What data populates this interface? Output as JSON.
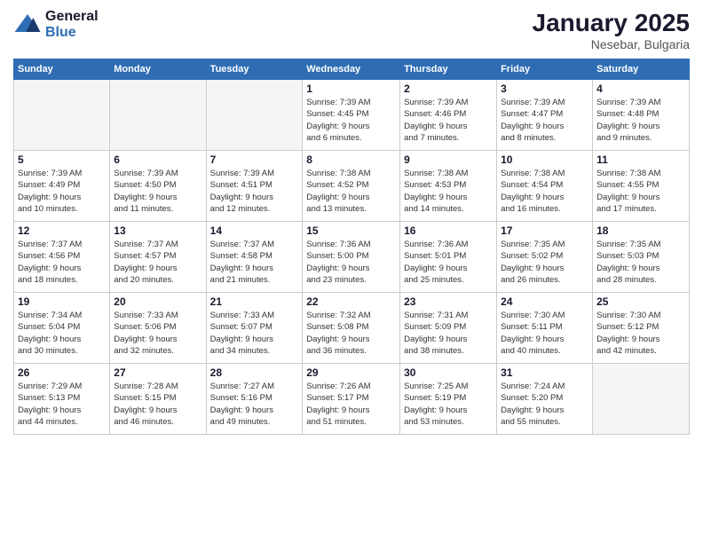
{
  "header": {
    "logo_line1": "General",
    "logo_line2": "Blue",
    "month": "January 2025",
    "location": "Nesebar, Bulgaria"
  },
  "weekdays": [
    "Sunday",
    "Monday",
    "Tuesday",
    "Wednesday",
    "Thursday",
    "Friday",
    "Saturday"
  ],
  "days": [
    {
      "num": "",
      "info": ""
    },
    {
      "num": "",
      "info": ""
    },
    {
      "num": "",
      "info": ""
    },
    {
      "num": "1",
      "info": "Sunrise: 7:39 AM\nSunset: 4:45 PM\nDaylight: 9 hours\nand 6 minutes."
    },
    {
      "num": "2",
      "info": "Sunrise: 7:39 AM\nSunset: 4:46 PM\nDaylight: 9 hours\nand 7 minutes."
    },
    {
      "num": "3",
      "info": "Sunrise: 7:39 AM\nSunset: 4:47 PM\nDaylight: 9 hours\nand 8 minutes."
    },
    {
      "num": "4",
      "info": "Sunrise: 7:39 AM\nSunset: 4:48 PM\nDaylight: 9 hours\nand 9 minutes."
    },
    {
      "num": "5",
      "info": "Sunrise: 7:39 AM\nSunset: 4:49 PM\nDaylight: 9 hours\nand 10 minutes."
    },
    {
      "num": "6",
      "info": "Sunrise: 7:39 AM\nSunset: 4:50 PM\nDaylight: 9 hours\nand 11 minutes."
    },
    {
      "num": "7",
      "info": "Sunrise: 7:39 AM\nSunset: 4:51 PM\nDaylight: 9 hours\nand 12 minutes."
    },
    {
      "num": "8",
      "info": "Sunrise: 7:38 AM\nSunset: 4:52 PM\nDaylight: 9 hours\nand 13 minutes."
    },
    {
      "num": "9",
      "info": "Sunrise: 7:38 AM\nSunset: 4:53 PM\nDaylight: 9 hours\nand 14 minutes."
    },
    {
      "num": "10",
      "info": "Sunrise: 7:38 AM\nSunset: 4:54 PM\nDaylight: 9 hours\nand 16 minutes."
    },
    {
      "num": "11",
      "info": "Sunrise: 7:38 AM\nSunset: 4:55 PM\nDaylight: 9 hours\nand 17 minutes."
    },
    {
      "num": "12",
      "info": "Sunrise: 7:37 AM\nSunset: 4:56 PM\nDaylight: 9 hours\nand 18 minutes."
    },
    {
      "num": "13",
      "info": "Sunrise: 7:37 AM\nSunset: 4:57 PM\nDaylight: 9 hours\nand 20 minutes."
    },
    {
      "num": "14",
      "info": "Sunrise: 7:37 AM\nSunset: 4:58 PM\nDaylight: 9 hours\nand 21 minutes."
    },
    {
      "num": "15",
      "info": "Sunrise: 7:36 AM\nSunset: 5:00 PM\nDaylight: 9 hours\nand 23 minutes."
    },
    {
      "num": "16",
      "info": "Sunrise: 7:36 AM\nSunset: 5:01 PM\nDaylight: 9 hours\nand 25 minutes."
    },
    {
      "num": "17",
      "info": "Sunrise: 7:35 AM\nSunset: 5:02 PM\nDaylight: 9 hours\nand 26 minutes."
    },
    {
      "num": "18",
      "info": "Sunrise: 7:35 AM\nSunset: 5:03 PM\nDaylight: 9 hours\nand 28 minutes."
    },
    {
      "num": "19",
      "info": "Sunrise: 7:34 AM\nSunset: 5:04 PM\nDaylight: 9 hours\nand 30 minutes."
    },
    {
      "num": "20",
      "info": "Sunrise: 7:33 AM\nSunset: 5:06 PM\nDaylight: 9 hours\nand 32 minutes."
    },
    {
      "num": "21",
      "info": "Sunrise: 7:33 AM\nSunset: 5:07 PM\nDaylight: 9 hours\nand 34 minutes."
    },
    {
      "num": "22",
      "info": "Sunrise: 7:32 AM\nSunset: 5:08 PM\nDaylight: 9 hours\nand 36 minutes."
    },
    {
      "num": "23",
      "info": "Sunrise: 7:31 AM\nSunset: 5:09 PM\nDaylight: 9 hours\nand 38 minutes."
    },
    {
      "num": "24",
      "info": "Sunrise: 7:30 AM\nSunset: 5:11 PM\nDaylight: 9 hours\nand 40 minutes."
    },
    {
      "num": "25",
      "info": "Sunrise: 7:30 AM\nSunset: 5:12 PM\nDaylight: 9 hours\nand 42 minutes."
    },
    {
      "num": "26",
      "info": "Sunrise: 7:29 AM\nSunset: 5:13 PM\nDaylight: 9 hours\nand 44 minutes."
    },
    {
      "num": "27",
      "info": "Sunrise: 7:28 AM\nSunset: 5:15 PM\nDaylight: 9 hours\nand 46 minutes."
    },
    {
      "num": "28",
      "info": "Sunrise: 7:27 AM\nSunset: 5:16 PM\nDaylight: 9 hours\nand 49 minutes."
    },
    {
      "num": "29",
      "info": "Sunrise: 7:26 AM\nSunset: 5:17 PM\nDaylight: 9 hours\nand 51 minutes."
    },
    {
      "num": "30",
      "info": "Sunrise: 7:25 AM\nSunset: 5:19 PM\nDaylight: 9 hours\nand 53 minutes."
    },
    {
      "num": "31",
      "info": "Sunrise: 7:24 AM\nSunset: 5:20 PM\nDaylight: 9 hours\nand 55 minutes."
    },
    {
      "num": "",
      "info": ""
    },
    {
      "num": "",
      "info": ""
    }
  ]
}
